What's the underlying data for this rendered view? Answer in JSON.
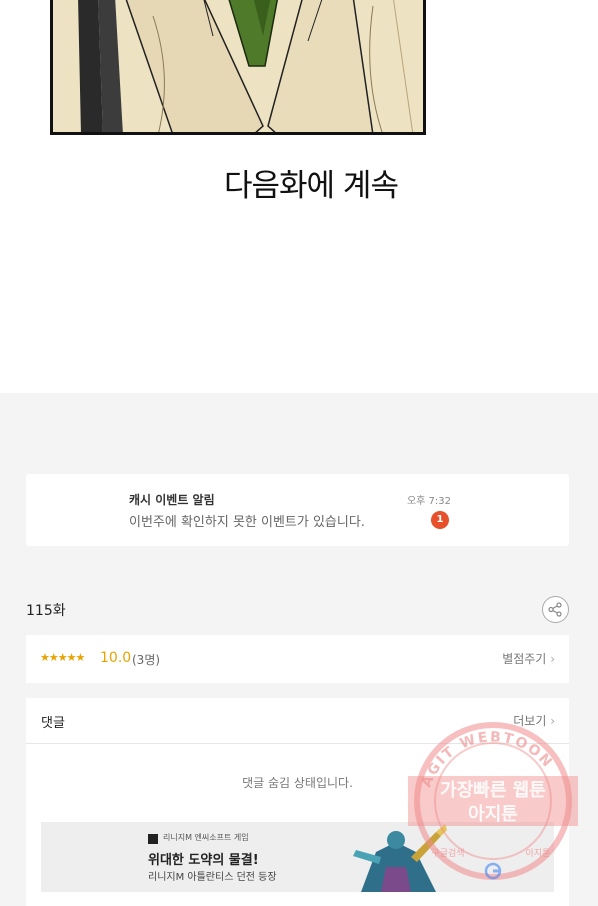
{
  "comic": {
    "continue_text": "다음화에 계속"
  },
  "notification": {
    "title": "캐시 이벤트 알림",
    "body": "이번주에 확인하지 못한 이벤트가 있습니다.",
    "time": "오후 7:32",
    "badge_count": "1",
    "badge_color": "#e8502a"
  },
  "episode": {
    "label": "115화"
  },
  "rating": {
    "stars": "★★★★★",
    "score": "10.0",
    "count": "(3명)",
    "action_label": "별점주기",
    "accent_color": "#e8a300"
  },
  "comments": {
    "title": "댓글",
    "more_label": "더보기",
    "hidden_message": "댓글 숨김 상태입니다."
  },
  "ad": {
    "brand": "리니지M 엔씨소프트 게임",
    "title": "위대한 도약의 물결!",
    "subtitle": "리니지M 아틀란티스 던전 등장"
  },
  "watermark": {
    "arc_text": "AGIT WEBTOON",
    "line1": "가장빠른 웹툰",
    "line2": "아지툰",
    "bottom_left": "구글검색",
    "bottom_right": "아지툰"
  }
}
